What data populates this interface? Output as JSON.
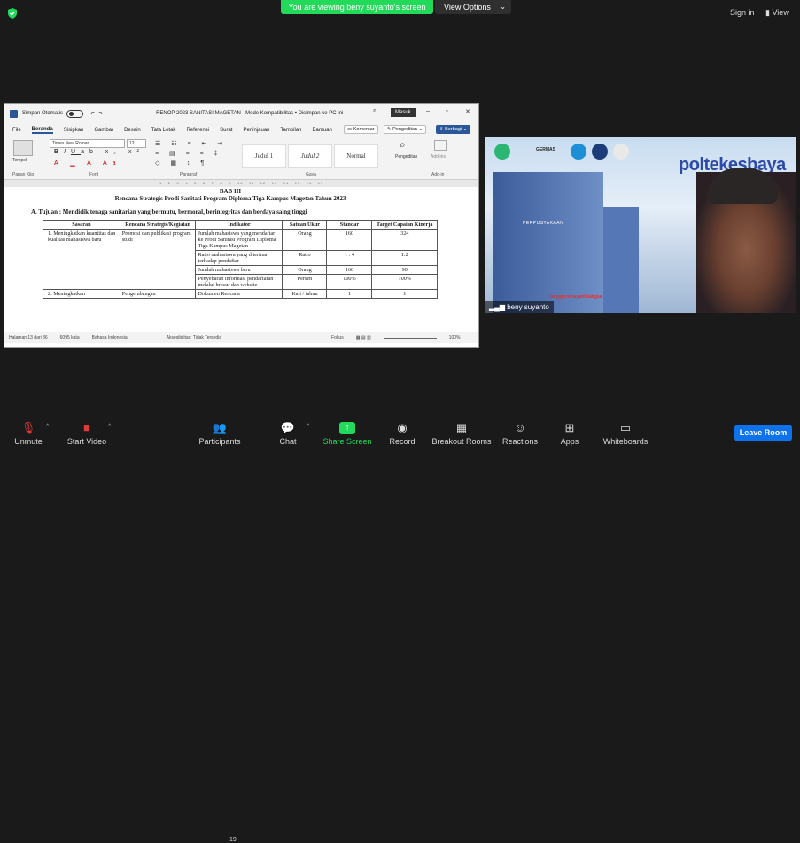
{
  "top": {
    "banner": "You are viewing beny suyanto's screen",
    "view_options": "View Options",
    "sign_in": "Sign in",
    "view": "View"
  },
  "word": {
    "autosave": "Simpan Otomatis",
    "filename": "RENOP 2023 SANITASI MAGETAN  -  Mode Kompatibilitas  •  Disimpan ke PC ini",
    "masuk": "Masuk",
    "menu": [
      "File",
      "Beranda",
      "Sisipkan",
      "Gambar",
      "Desain",
      "Tata Letak",
      "Referensi",
      "Surat",
      "Peninjauan",
      "Tampilan",
      "Bantuan"
    ],
    "komentar": "Komentar",
    "pengeditan": "Pengeditan",
    "berbagi": "Berbagi",
    "ribbon": {
      "tempel": "Tempel",
      "font_name": "Times New Roman",
      "font_size": "12",
      "styles": [
        "Judul 1",
        "Judul 2",
        "Normal"
      ],
      "pengeditan": "Pengeditan",
      "addins": "Add-ins",
      "sections": [
        "Papan Klip",
        "Font",
        "Paragraf",
        "Gaya",
        "Add-in"
      ]
    },
    "doc": {
      "bab": "BAB III",
      "rencana": "Rencana Strategis Prodi Sanitasi Program Diploma Tiga Kampus Magetan Tahun 2023",
      "tujuan": "A.   Tujuan : Mendidik tenaga sanitarian yang bermutu, bermoral, berintegritas dan berdaya saing tinggi",
      "headers": [
        "Sasaran",
        "Rencana Strategis/Kegiatan",
        "Indikator",
        "Satuan Ukur",
        "Standar",
        "Target Capaian Kinerja"
      ],
      "rows": [
        {
          "sasaran": "1. Meningkatkan kuantitas dan kualitas mahasiswa baru",
          "kegiatan": "Promosi dan publikasi program studi",
          "indikator": "Jumlah mahasiswa yang mendaftar ke Prodi Sanitasi Program Diploma Tiga Kampus Magetan",
          "satuan": "Orang",
          "standar": "160",
          "target": "324"
        },
        {
          "sasaran": "",
          "kegiatan": "",
          "indikator": "Ratio mahasiswa yang diterima terhadap pendaftar",
          "satuan": "Ratio",
          "standar": "1 : 4",
          "target": "1:2"
        },
        {
          "sasaran": "",
          "kegiatan": "",
          "indikator": "Jumlah mahasiswa baru",
          "satuan": "Orang",
          "standar": "160",
          "target": "90"
        },
        {
          "sasaran": "",
          "kegiatan": "",
          "indikator": "Penyebaran informasi pendaftaran melalui brosur dan website",
          "satuan": "Persen",
          "standar": "100%",
          "target": "100%"
        },
        {
          "sasaran": "2. Meningkatkan",
          "kegiatan": "Pengembangan",
          "indikator": "Dokumen Rencana",
          "satuan": "Kali / tahun",
          "standar": "1",
          "target": "1"
        }
      ]
    },
    "status": {
      "page": "Halaman 13 dari 36",
      "words": "6095 kata",
      "lang": "Bahasa Indonesia",
      "access": "Aksesibilitas: Tidak Tersedia",
      "focus": "Fokus",
      "zoom": "100%"
    }
  },
  "video": {
    "name": "beny suyanto",
    "brand": "poltekesbaya",
    "germas": "GERMAS",
    "library": "PERPUSTAKAAN",
    "bangga": "bangga melayani bangsa"
  },
  "toolbar": {
    "items": [
      "Unmute",
      "Start Video",
      "Participants",
      "Chat",
      "Share Screen",
      "Record",
      "Breakout Rooms",
      "Reactions",
      "Apps",
      "Whiteboards"
    ],
    "participants_count": "19",
    "leave": "Leave Room"
  },
  "colors": {
    "accent_green": "#23d959",
    "zoom_blue": "#0e72ed",
    "word_blue": "#2b579a"
  }
}
